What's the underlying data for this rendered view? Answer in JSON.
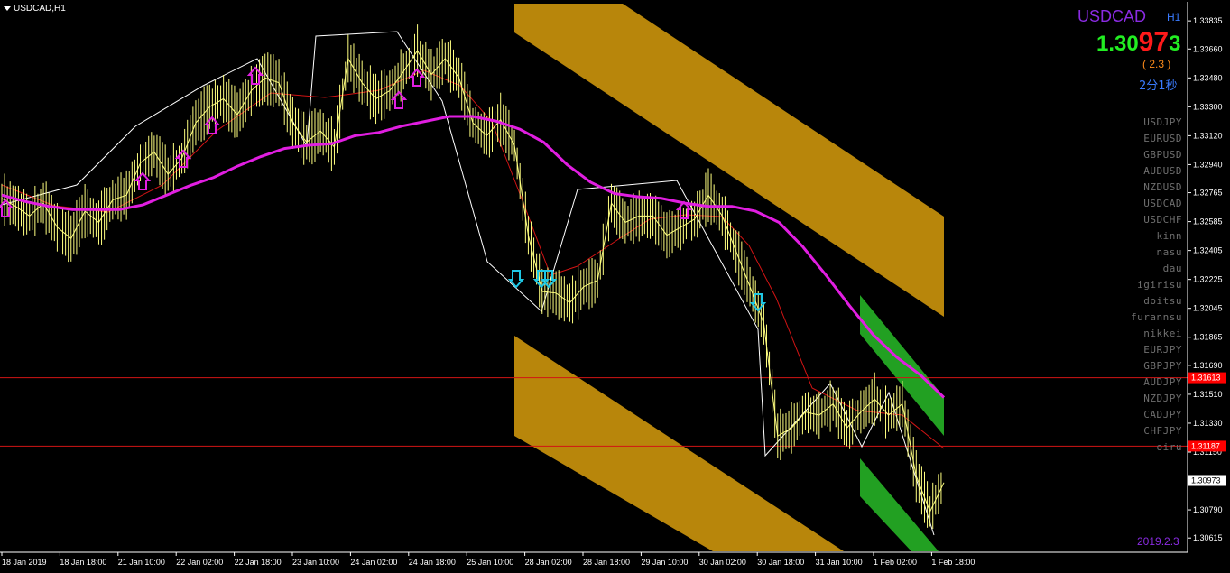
{
  "header": {
    "title": "USDCAD,H1"
  },
  "info_panel": {
    "symbol": "USDCAD",
    "timeframe": "H1",
    "price_part1": "1.30",
    "price_part2": "97",
    "price_part3": "3",
    "spread": "( 2.3 )",
    "countdown": "2分1秒",
    "version": "2019.2.3"
  },
  "pair_list": [
    "USDJPY",
    "EURUSD",
    "GBPUSD",
    "AUDUSD",
    "NZDUSD",
    "USDCAD",
    "USDCHF",
    "kinn",
    "nasu",
    "dau",
    "igirisu",
    "doitsu",
    "furannsu",
    "nikkei",
    "EURJPY",
    "GBPJPY",
    "AUDJPY",
    "NZDJPY",
    "CADJPY",
    "CHFJPY",
    "oiru"
  ],
  "price_axis": {
    "ticks": [
      "1.33835",
      "1.33660",
      "1.33480",
      "1.33300",
      "1.33120",
      "1.32940",
      "1.32765",
      "1.32585",
      "1.32405",
      "1.32225",
      "1.32045",
      "1.31865",
      "1.31690",
      "1.31510",
      "1.31330",
      "1.31150",
      "1.30970",
      "1.30790",
      "1.30615"
    ],
    "markers": [
      {
        "label": "1.31613",
        "color": "#ff0000",
        "value": 1.31613
      },
      {
        "label": "1.31187",
        "color": "#ff0000",
        "value": 1.31187
      },
      {
        "label": "1.30973",
        "color": "#ffffff",
        "value": 1.30973
      }
    ]
  },
  "time_axis": {
    "ticks": [
      "18 Jan 2019",
      "18 Jan 18:00",
      "21 Jan 10:00",
      "22 Jan 02:00",
      "22 Jan 18:00",
      "23 Jan 10:00",
      "24 Jan 02:00",
      "24 Jan 18:00",
      "25 Jan 10:00",
      "28 Jan 02:00",
      "28 Jan 18:00",
      "29 Jan 10:00",
      "30 Jan 02:00",
      "30 Jan 18:00",
      "31 Jan 10:00",
      "1 Feb 02:00",
      "1 Feb 18:00"
    ]
  },
  "chart_data": {
    "type": "line",
    "symbol": "USDCAD",
    "timeframe": "H1",
    "ylim": [
      1.3056,
      1.3392
    ],
    "series": [
      {
        "name": "close",
        "color": "#ffff80",
        "values": [
          1.3273,
          1.3268,
          1.3262,
          1.327,
          1.3255,
          1.3248,
          1.3265,
          1.3258,
          1.3272,
          1.3275,
          1.3295,
          1.3302,
          1.3288,
          1.3298,
          1.332,
          1.333,
          1.3335,
          1.3325,
          1.334,
          1.3348,
          1.3345,
          1.332,
          1.3308,
          1.3315,
          1.3305,
          1.336,
          1.3345,
          1.3335,
          1.334,
          1.3352,
          1.3365,
          1.335,
          1.336,
          1.3348,
          1.332,
          1.3312,
          1.3322,
          1.3306,
          1.325,
          1.3215,
          1.3214,
          1.3208,
          1.3218,
          1.3222,
          1.327,
          1.3258,
          1.3262,
          1.3262,
          1.325,
          1.3255,
          1.326,
          1.3275,
          1.3262,
          1.324,
          1.3218,
          1.3195,
          1.3125,
          1.313,
          1.314,
          1.3138,
          1.3145,
          1.313,
          1.314,
          1.3148,
          1.3138,
          1.3145,
          1.31,
          1.3078,
          1.3096
        ]
      },
      {
        "name": "ma",
        "color": "#ff00ff",
        "values": [
          1.3275,
          1.3271,
          1.3268,
          1.3266,
          1.3266,
          1.3266,
          1.3269,
          1.3275,
          1.3281,
          1.3286,
          1.3293,
          1.3299,
          1.3304,
          1.3306,
          1.3307,
          1.3312,
          1.3314,
          1.3318,
          1.3321,
          1.3324,
          1.3324,
          1.3321,
          1.3316,
          1.3308,
          1.3294,
          1.3283,
          1.3276,
          1.3274,
          1.3273,
          1.327,
          1.3268,
          1.3268,
          1.3265,
          1.3258,
          1.3243,
          1.3225,
          1.3206,
          1.3188,
          1.3174,
          1.3163,
          1.3149
        ]
      }
    ],
    "levels": [
      1.31613,
      1.31187
    ],
    "last_price": 1.30973
  }
}
